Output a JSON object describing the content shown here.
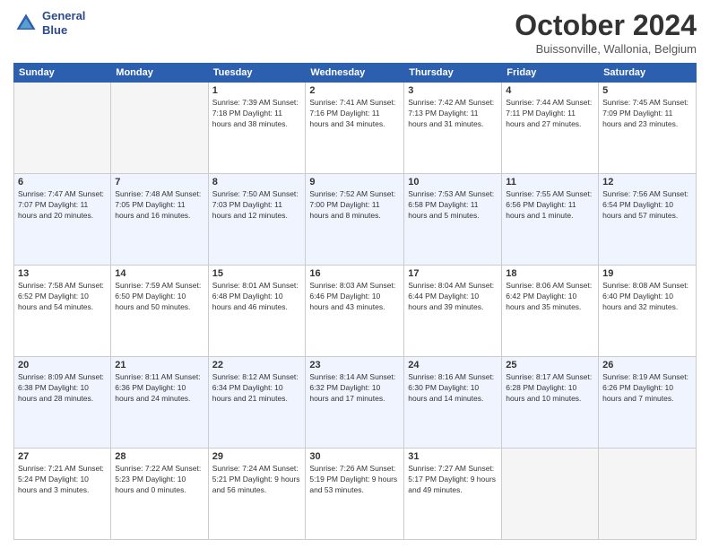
{
  "logo": {
    "line1": "General",
    "line2": "Blue"
  },
  "header": {
    "title": "October 2024",
    "location": "Buissonville, Wallonia, Belgium"
  },
  "weekdays": [
    "Sunday",
    "Monday",
    "Tuesday",
    "Wednesday",
    "Thursday",
    "Friday",
    "Saturday"
  ],
  "weeks": [
    [
      {
        "day": "",
        "detail": ""
      },
      {
        "day": "",
        "detail": ""
      },
      {
        "day": "1",
        "detail": "Sunrise: 7:39 AM\nSunset: 7:18 PM\nDaylight: 11 hours\nand 38 minutes."
      },
      {
        "day": "2",
        "detail": "Sunrise: 7:41 AM\nSunset: 7:16 PM\nDaylight: 11 hours\nand 34 minutes."
      },
      {
        "day": "3",
        "detail": "Sunrise: 7:42 AM\nSunset: 7:13 PM\nDaylight: 11 hours\nand 31 minutes."
      },
      {
        "day": "4",
        "detail": "Sunrise: 7:44 AM\nSunset: 7:11 PM\nDaylight: 11 hours\nand 27 minutes."
      },
      {
        "day": "5",
        "detail": "Sunrise: 7:45 AM\nSunset: 7:09 PM\nDaylight: 11 hours\nand 23 minutes."
      }
    ],
    [
      {
        "day": "6",
        "detail": "Sunrise: 7:47 AM\nSunset: 7:07 PM\nDaylight: 11 hours\nand 20 minutes."
      },
      {
        "day": "7",
        "detail": "Sunrise: 7:48 AM\nSunset: 7:05 PM\nDaylight: 11 hours\nand 16 minutes."
      },
      {
        "day": "8",
        "detail": "Sunrise: 7:50 AM\nSunset: 7:03 PM\nDaylight: 11 hours\nand 12 minutes."
      },
      {
        "day": "9",
        "detail": "Sunrise: 7:52 AM\nSunset: 7:00 PM\nDaylight: 11 hours\nand 8 minutes."
      },
      {
        "day": "10",
        "detail": "Sunrise: 7:53 AM\nSunset: 6:58 PM\nDaylight: 11 hours\nand 5 minutes."
      },
      {
        "day": "11",
        "detail": "Sunrise: 7:55 AM\nSunset: 6:56 PM\nDaylight: 11 hours\nand 1 minute."
      },
      {
        "day": "12",
        "detail": "Sunrise: 7:56 AM\nSunset: 6:54 PM\nDaylight: 10 hours\nand 57 minutes."
      }
    ],
    [
      {
        "day": "13",
        "detail": "Sunrise: 7:58 AM\nSunset: 6:52 PM\nDaylight: 10 hours\nand 54 minutes."
      },
      {
        "day": "14",
        "detail": "Sunrise: 7:59 AM\nSunset: 6:50 PM\nDaylight: 10 hours\nand 50 minutes."
      },
      {
        "day": "15",
        "detail": "Sunrise: 8:01 AM\nSunset: 6:48 PM\nDaylight: 10 hours\nand 46 minutes."
      },
      {
        "day": "16",
        "detail": "Sunrise: 8:03 AM\nSunset: 6:46 PM\nDaylight: 10 hours\nand 43 minutes."
      },
      {
        "day": "17",
        "detail": "Sunrise: 8:04 AM\nSunset: 6:44 PM\nDaylight: 10 hours\nand 39 minutes."
      },
      {
        "day": "18",
        "detail": "Sunrise: 8:06 AM\nSunset: 6:42 PM\nDaylight: 10 hours\nand 35 minutes."
      },
      {
        "day": "19",
        "detail": "Sunrise: 8:08 AM\nSunset: 6:40 PM\nDaylight: 10 hours\nand 32 minutes."
      }
    ],
    [
      {
        "day": "20",
        "detail": "Sunrise: 8:09 AM\nSunset: 6:38 PM\nDaylight: 10 hours\nand 28 minutes."
      },
      {
        "day": "21",
        "detail": "Sunrise: 8:11 AM\nSunset: 6:36 PM\nDaylight: 10 hours\nand 24 minutes."
      },
      {
        "day": "22",
        "detail": "Sunrise: 8:12 AM\nSunset: 6:34 PM\nDaylight: 10 hours\nand 21 minutes."
      },
      {
        "day": "23",
        "detail": "Sunrise: 8:14 AM\nSunset: 6:32 PM\nDaylight: 10 hours\nand 17 minutes."
      },
      {
        "day": "24",
        "detail": "Sunrise: 8:16 AM\nSunset: 6:30 PM\nDaylight: 10 hours\nand 14 minutes."
      },
      {
        "day": "25",
        "detail": "Sunrise: 8:17 AM\nSunset: 6:28 PM\nDaylight: 10 hours\nand 10 minutes."
      },
      {
        "day": "26",
        "detail": "Sunrise: 8:19 AM\nSunset: 6:26 PM\nDaylight: 10 hours\nand 7 minutes."
      }
    ],
    [
      {
        "day": "27",
        "detail": "Sunrise: 7:21 AM\nSunset: 5:24 PM\nDaylight: 10 hours\nand 3 minutes."
      },
      {
        "day": "28",
        "detail": "Sunrise: 7:22 AM\nSunset: 5:23 PM\nDaylight: 10 hours\nand 0 minutes."
      },
      {
        "day": "29",
        "detail": "Sunrise: 7:24 AM\nSunset: 5:21 PM\nDaylight: 9 hours\nand 56 minutes."
      },
      {
        "day": "30",
        "detail": "Sunrise: 7:26 AM\nSunset: 5:19 PM\nDaylight: 9 hours\nand 53 minutes."
      },
      {
        "day": "31",
        "detail": "Sunrise: 7:27 AM\nSunset: 5:17 PM\nDaylight: 9 hours\nand 49 minutes."
      },
      {
        "day": "",
        "detail": ""
      },
      {
        "day": "",
        "detail": ""
      }
    ]
  ]
}
